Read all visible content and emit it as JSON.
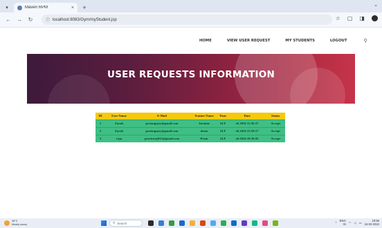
{
  "browser": {
    "tab_title": "Maven RPM",
    "tab_close": "×",
    "new_tab": "+",
    "url": "localhost:8083/Gym/myStudent.jsp",
    "icons": [
      "back-icon",
      "forward-icon",
      "reload-icon",
      "lock-icon",
      "star-icon",
      "extensions-icon",
      "sidepanel-icon",
      "profile-icon"
    ]
  },
  "site_nav": {
    "items": [
      {
        "label": "HOME"
      },
      {
        "label": "VIEW USER REQUEST"
      },
      {
        "label": "MY STUDENTS"
      },
      {
        "label": "LOGOUT"
      }
    ],
    "search_icon": "search-icon"
  },
  "hero": {
    "title": "USER REQUESTS INFORMATION",
    "colors": {
      "start": "#3d1a3b",
      "end": "#c6344a"
    }
  },
  "table": {
    "headers": [
      "ID",
      "User Name",
      "E-Mail",
      "Trainer Name",
      "Time",
      "Date",
      "Status"
    ],
    "rows": [
      {
        "id": "1",
        "user": "Zarah",
        "email": "pratmgsjoy@gmail.com",
        "trainer": "Jasmine",
        "time": "24 F",
        "date": "eb 2024 11:56:37",
        "status": "Accept"
      },
      {
        "id": "2",
        "user": "Zarah",
        "email": "pratmgsjoy@gmail.com",
        "trainer": "demo",
        "time": "24 F",
        "date": "eb 2024 15:58:17",
        "status": "Accept"
      },
      {
        "id": "3",
        "user": "raja",
        "email": "pravinraj012@gmail.com",
        "trainer": "Pram",
        "time": "24 F",
        "date": "eb 2024 18:39:45",
        "status": "Accept"
      }
    ],
    "colors": {
      "header": "#f6c90e",
      "row": "#3fbf84"
    }
  },
  "taskbar": {
    "weather_temp": "28°C",
    "weather_desc": "Mostly sunny",
    "search_placeholder": "Search",
    "lang": "ENG",
    "lang_sub": "IN",
    "time": "19:59",
    "date": "16-02-2024"
  }
}
